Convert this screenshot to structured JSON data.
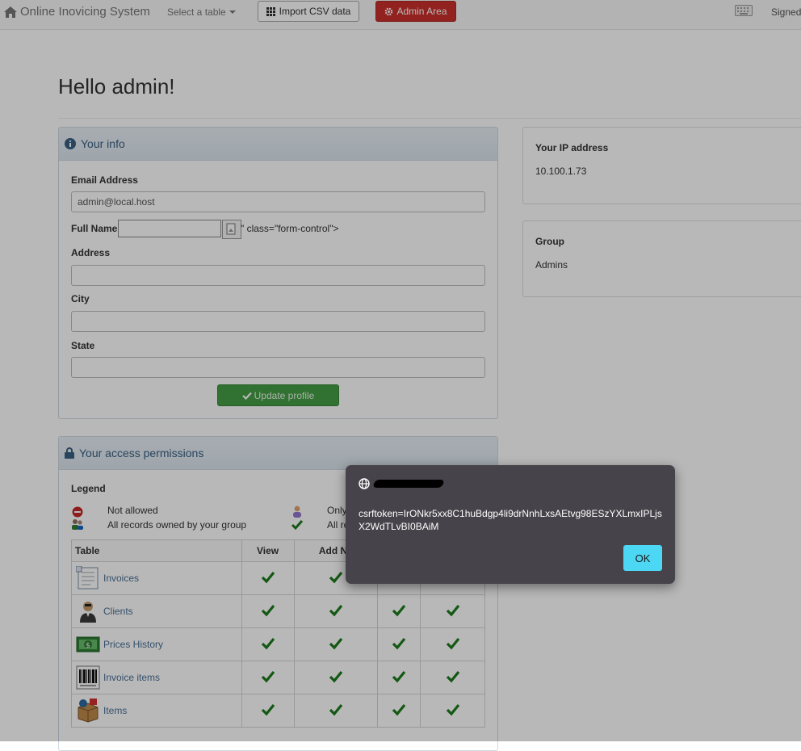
{
  "navbar": {
    "brand": "Online Inovicing System",
    "select_table": "Select a table",
    "import_csv": "Import CSV data",
    "admin_area": "Admin Area",
    "signed": "Signed"
  },
  "page": {
    "greeting": "Hello admin!"
  },
  "info_panel": {
    "title": "Your info",
    "email_label": "Email Address",
    "email_value": "admin@local.host",
    "fullname_label": "Full Name",
    "fullname_trailing": "\" class=\"form-control\">",
    "address_label": "Address",
    "city_label": "City",
    "state_label": "State",
    "update_button": "Update profile"
  },
  "ip_panel": {
    "title": "Your IP address",
    "value": "10.100.1.73"
  },
  "group_panel": {
    "title": "Group",
    "value": "Admins"
  },
  "permissions_panel": {
    "title": "Your access permissions",
    "legend_label": "Legend",
    "legend": {
      "not_allowed": "Not allowed",
      "group_records": "All records owned by your group",
      "only": "Only",
      "all_records": "All re"
    },
    "columns": [
      "Table",
      "View",
      "Add Ne"
    ],
    "rows": [
      {
        "name": "Invoices",
        "icon": "invoice-icon"
      },
      {
        "name": "Clients",
        "icon": "client-icon"
      },
      {
        "name": "Prices History",
        "icon": "money-icon"
      },
      {
        "name": "Invoice items",
        "icon": "barcode-icon"
      },
      {
        "name": "Items",
        "icon": "box-icon"
      }
    ]
  },
  "dialog": {
    "message": "csrftoken=IrONkr5xx8C1huBdgp4li9drNnhLxsAEtvg98ESzYXLmxIPLjsX2WdTLvBI0BAiM",
    "ok_label": "OK"
  },
  "colors": {
    "admin": "#c9302c",
    "update": "#449d44",
    "dialog": "#47434a",
    "ok": "#4cd7f5"
  }
}
